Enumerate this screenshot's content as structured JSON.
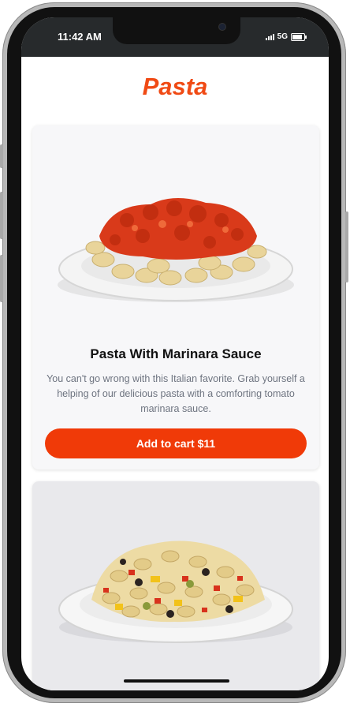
{
  "status": {
    "time": "11:42 AM",
    "network": "5G"
  },
  "page": {
    "title": "Pasta"
  },
  "items": [
    {
      "name": "Pasta With Marinara Sauce",
      "description": "You can't go wrong with this Italian favorite. Grab yourself a helping of our delicious pasta with a comforting tomato marinara sauce.",
      "button_label": "Add to cart $11"
    },
    {
      "name": "",
      "description": "",
      "button_label": ""
    }
  ],
  "colors": {
    "accent": "#f03a08",
    "title": "#f04a14",
    "card_bg": "#f7f7f9"
  }
}
